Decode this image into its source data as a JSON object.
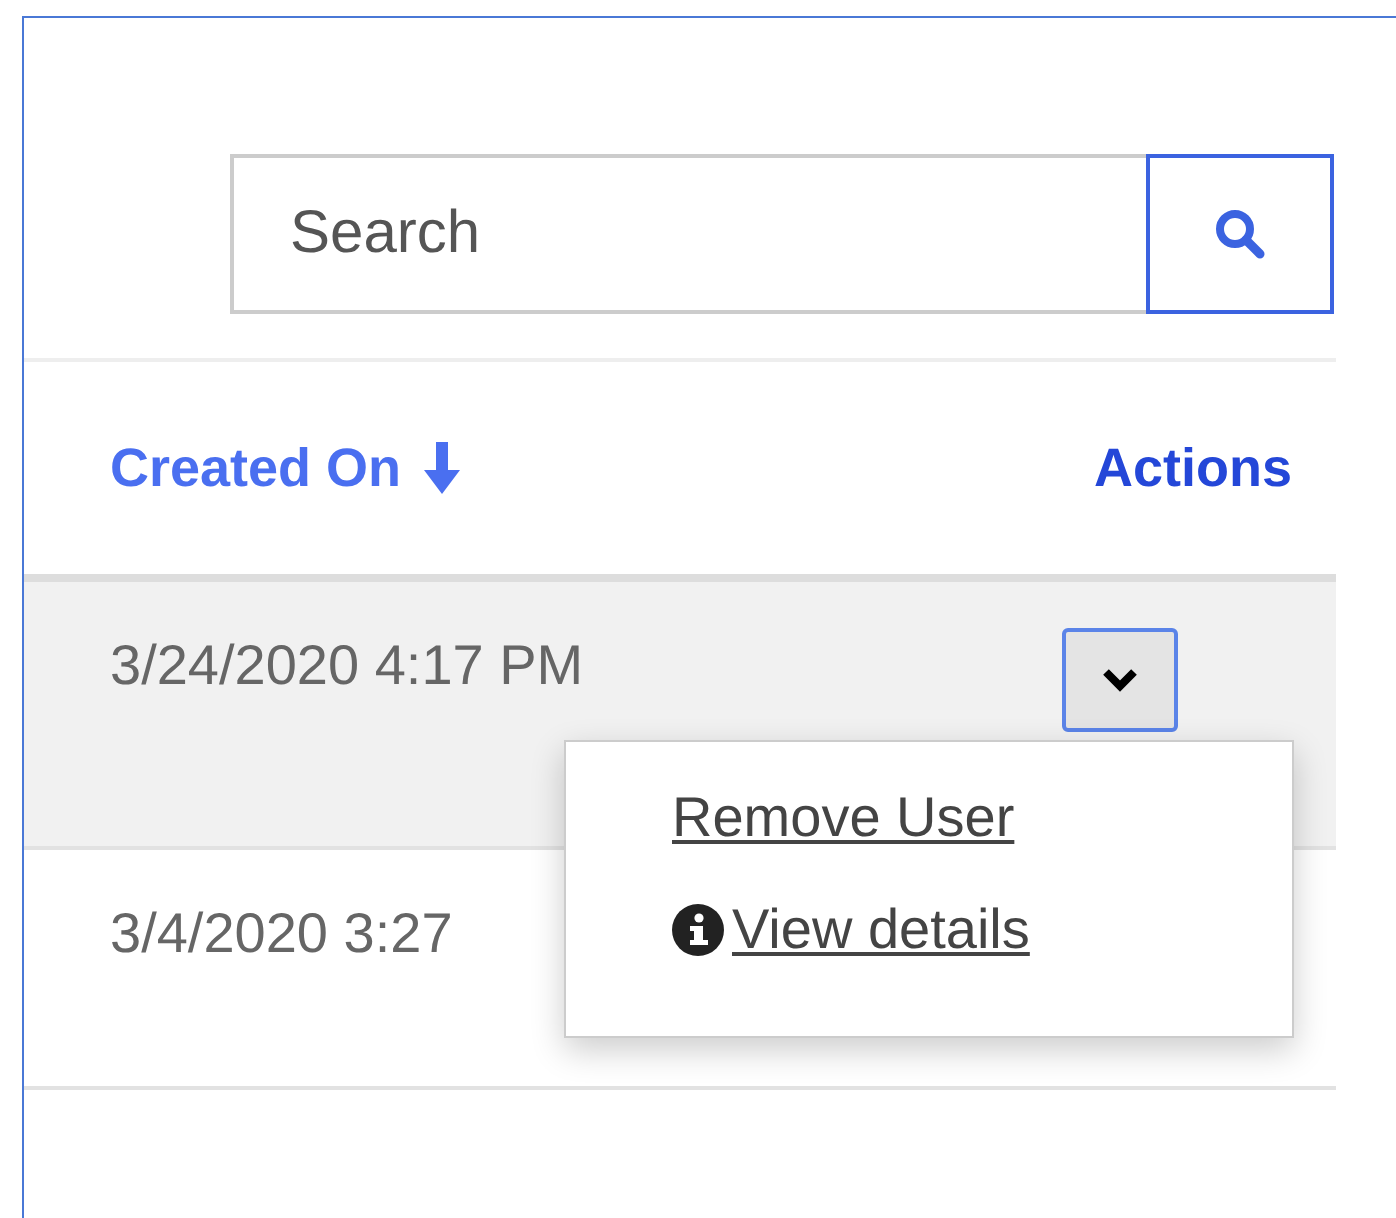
{
  "search": {
    "placeholder": "Search"
  },
  "table": {
    "columns": [
      {
        "label": "Created On",
        "sorted": true
      },
      {
        "label": "Actions",
        "sorted": false
      }
    ],
    "rows": [
      {
        "created_on": "3/24/2020 4:17 PM",
        "selected": true
      },
      {
        "created_on": "3/4/2020 3:27",
        "selected": false
      }
    ]
  },
  "action_menu": {
    "items": [
      {
        "label": "Remove User",
        "kind": "plain"
      },
      {
        "label": "View details",
        "kind": "info"
      }
    ]
  }
}
